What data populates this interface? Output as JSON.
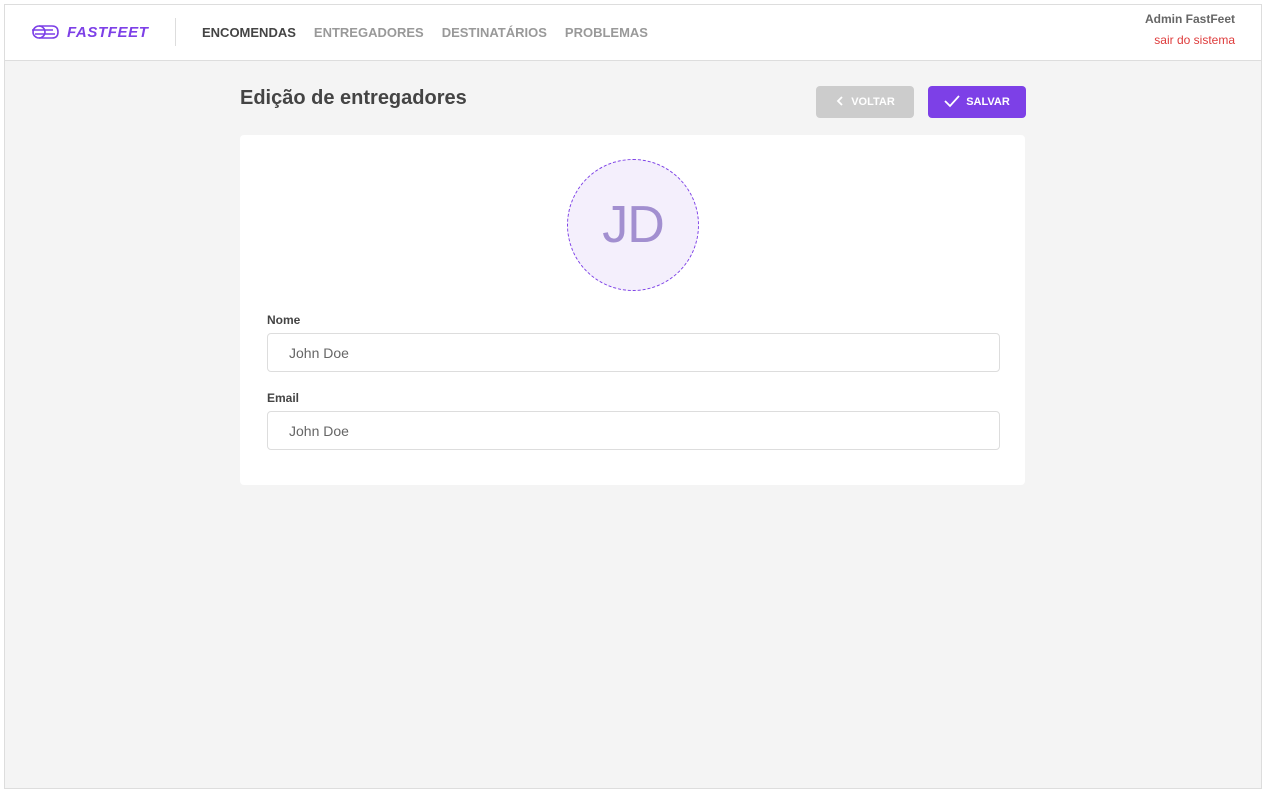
{
  "header": {
    "logo_text": "FASTFEET",
    "nav": [
      {
        "label": "ENCOMENDAS",
        "active": true
      },
      {
        "label": "ENTREGADORES",
        "active": false
      },
      {
        "label": "DESTINATÁRIOS",
        "active": false
      },
      {
        "label": "PROBLEMAS",
        "active": false
      }
    ],
    "user_name": "Admin FastFeet",
    "logout_label": "sair do sistema"
  },
  "page": {
    "title": "Edição de entregadores",
    "back_label": "VOLTAR",
    "save_label": "SALVAR"
  },
  "form": {
    "avatar_initials": "JD",
    "name_label": "Nome",
    "name_value": "John Doe",
    "email_label": "Email",
    "email_value": "John Doe"
  },
  "colors": {
    "accent": "#7d40e7",
    "danger": "#de3b3b",
    "background": "#f4f4f4",
    "back_button": "#cccccc"
  },
  "icons": {
    "logo": "fast-truck-icon",
    "back": "chevron-left-icon",
    "save": "check-icon"
  }
}
